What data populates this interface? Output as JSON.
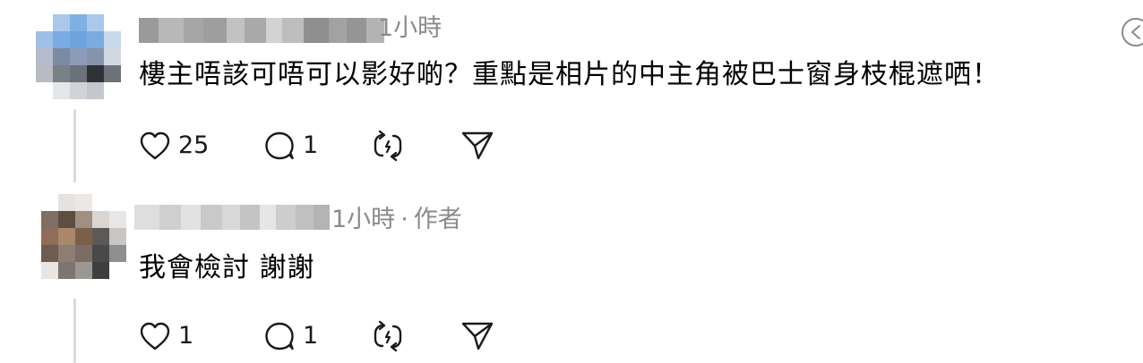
{
  "comments": [
    {
      "author_name": "",
      "meta": {
        "time": "1小時",
        "tag": ""
      },
      "text": "樓主唔該可唔可以影好啲？重點是相片的中主角被巴士窗身枝棍遮哂！",
      "actions": {
        "like_count": "25",
        "reply_count": "1"
      },
      "icons": [
        "heart-icon",
        "comment-icon",
        "repost-icon",
        "share-icon"
      ]
    },
    {
      "author_name": "",
      "meta": {
        "time": "1小時",
        "separator": "·",
        "tag": "作者"
      },
      "text": "我會檢討 謝謝",
      "actions": {
        "like_count": "1",
        "reply_count": "1"
      },
      "icons": [
        "heart-icon",
        "comment-icon",
        "repost-icon",
        "share-icon"
      ]
    }
  ],
  "colors": {
    "meta_gray": "#8a8a8a",
    "thread_line": "#d9d9d9",
    "icon_stroke": "#1a1a1a"
  },
  "corner_icon": "more-options-icon"
}
